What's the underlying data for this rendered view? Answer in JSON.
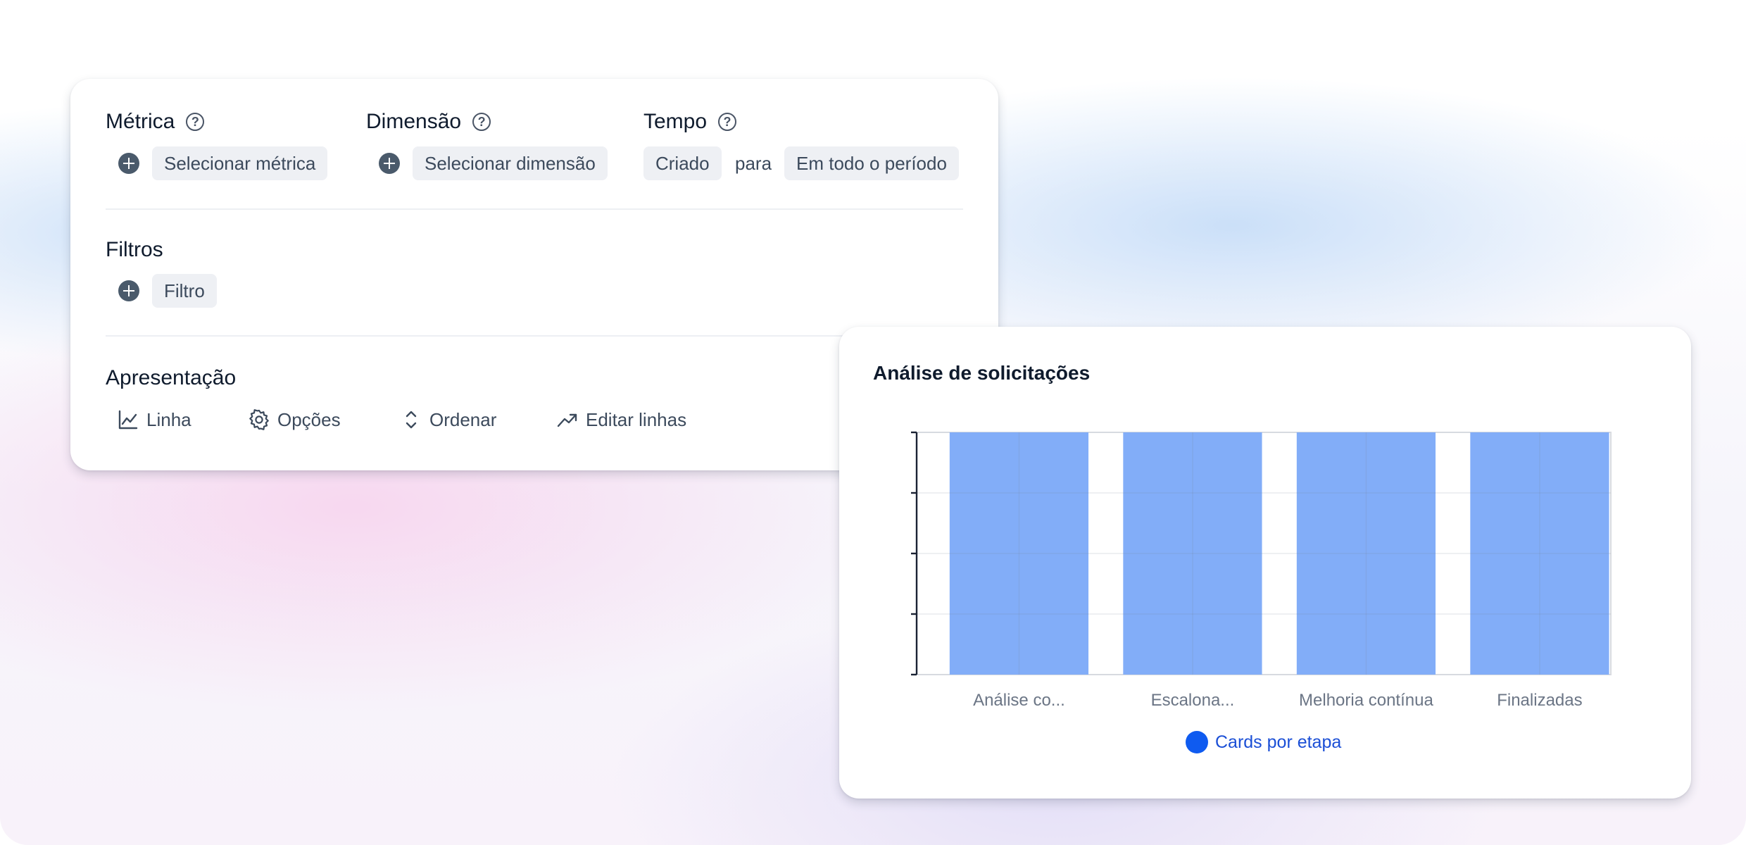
{
  "config": {
    "metric": {
      "title": "Métrica",
      "select_label": "Selecionar métrica"
    },
    "dimension": {
      "title": "Dimensão",
      "select_label": "Selecionar dimensão"
    },
    "time": {
      "title": "Tempo",
      "created_label": "Criado",
      "connector": "para",
      "range_label": "Em todo o período"
    },
    "filters": {
      "title": "Filtros",
      "filter_label": "Filtro"
    },
    "presentation": {
      "title": "Apresentação",
      "items": [
        {
          "label": "Linha",
          "icon": "line-chart-icon"
        },
        {
          "label": "Opções",
          "icon": "gear-icon"
        },
        {
          "label": "Ordenar",
          "icon": "sort-chevrons-icon"
        },
        {
          "label": "Editar linhas",
          "icon": "trend-arrow-icon"
        }
      ]
    },
    "help_glyph": "?"
  },
  "chart": {
    "title": "Análise de solicitações",
    "legend_label": "Cards por etapa",
    "colors": {
      "bar": "#82adf8",
      "legend_dot": "#0f5bf0",
      "legend_text": "#1b4fd6"
    }
  },
  "chart_data": {
    "type": "bar",
    "title": "Análise de solicitações",
    "categories": [
      "Análise co...",
      "Escalona...",
      "Melhoria contínua",
      "Finalizadas"
    ],
    "series": [
      {
        "name": "Cards por etapa",
        "values": [
          4,
          4,
          4,
          4
        ]
      }
    ],
    "ylim": [
      0,
      4
    ],
    "grid": true,
    "legend": "bottom-center",
    "xlabel": "",
    "ylabel": ""
  }
}
